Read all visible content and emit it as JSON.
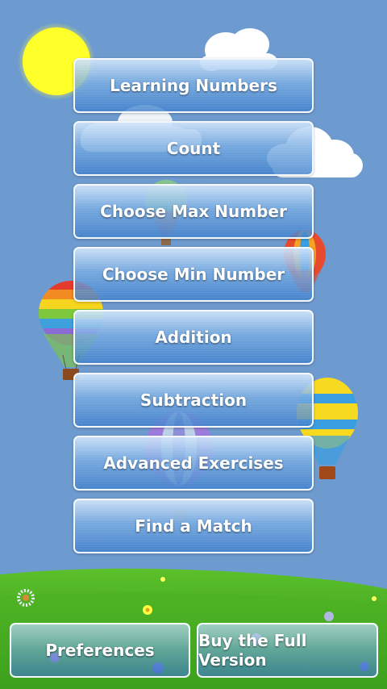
{
  "menu": {
    "items": [
      {
        "label": "Learning Numbers"
      },
      {
        "label": "Count"
      },
      {
        "label": "Choose Max Number"
      },
      {
        "label": "Choose Min Number"
      },
      {
        "label": "Addition"
      },
      {
        "label": "Subtraction"
      },
      {
        "label": "Advanced Exercises"
      },
      {
        "label": "Find a Match"
      }
    ]
  },
  "footer": {
    "preferences_label": "Preferences",
    "buy_label": "Buy the Full Version"
  },
  "colors": {
    "sky": "#6e9bcf",
    "sun": "#ffff2a",
    "grass": "#3fae1e"
  },
  "icons": [
    "sun-icon",
    "cloud-icon",
    "hot-air-balloon-icon",
    "flower-icon"
  ]
}
